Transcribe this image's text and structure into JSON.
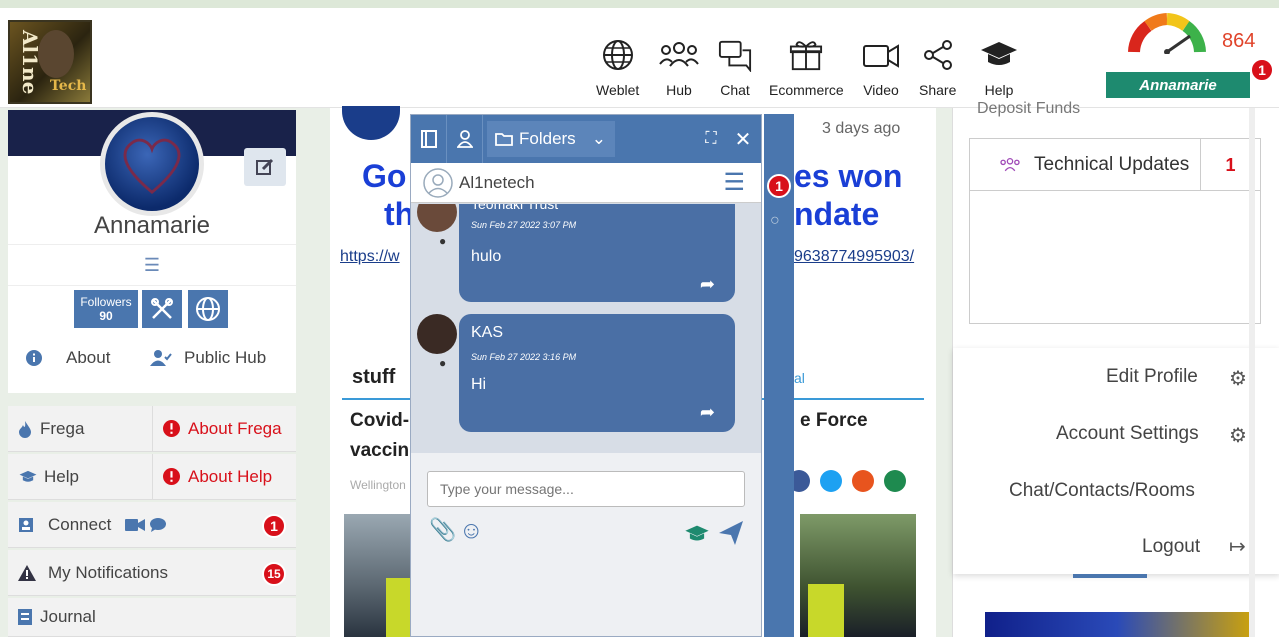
{
  "header": {
    "nav": [
      {
        "label": "Weblet",
        "icon": "globe-icon"
      },
      {
        "label": "Hub",
        "icon": "people-icon"
      },
      {
        "label": "Chat",
        "icon": "chat-icon"
      },
      {
        "label": "Ecommerce",
        "icon": "gift-icon"
      },
      {
        "label": "Video",
        "icon": "video-icon"
      },
      {
        "label": "Share",
        "icon": "share-icon"
      },
      {
        "label": "Help",
        "icon": "graduation-cap-icon"
      }
    ],
    "score": "864",
    "username": "Annamarie",
    "notification_count": "1"
  },
  "profile": {
    "name": "Annamarie",
    "followers_label": "Followers",
    "followers_count": "90",
    "about": "About",
    "public_hub": "Public Hub"
  },
  "left_menu": {
    "frega": "Frega",
    "about_frega": "About Frega",
    "help": "Help",
    "about_help": "About Help",
    "connect": "Connect",
    "connect_badge": "1",
    "notifications": "My Notifications",
    "notifications_badge": "15",
    "journal": "Journal"
  },
  "feed": {
    "time": "3 days ago",
    "headline_part1": "Go",
    "headline_part2": "es won",
    "headline_part3": "th",
    "headline_part4": "ndate",
    "link_start": "https://w",
    "link_end": "9638774995903/",
    "source": "stuff",
    "source_right": "al",
    "title_part1": "Covid-",
    "title_part2": "vaccin",
    "title_right": "e Force",
    "location": "Wellington"
  },
  "chat": {
    "folders_label": "Folders",
    "contact": "Al1netech",
    "messages": [
      {
        "sender": "Teomaki Trust",
        "time": "Sun Feb 27 2022 3:07 PM",
        "text": "hulo"
      },
      {
        "sender": "KAS",
        "time": "Sun Feb 27 2022 3:16 PM",
        "text": "Hi"
      }
    ],
    "input_placeholder": "Type your message...",
    "strip_badge": "1"
  },
  "right_panel": {
    "deposit": "Deposit Funds",
    "tech_updates": "Technical Updates",
    "tech_count": "1",
    "edit_profile": "Edit Profile",
    "account_settings": "Account Settings",
    "chat_contacts": "Chat/Contacts/Rooms",
    "logout": "Logout"
  },
  "colors": {
    "primary_blue": "#4a76ae",
    "brand_green": "#1e8a6f",
    "alert_red": "#d8101a",
    "headline_blue": "#1a3fd6"
  }
}
